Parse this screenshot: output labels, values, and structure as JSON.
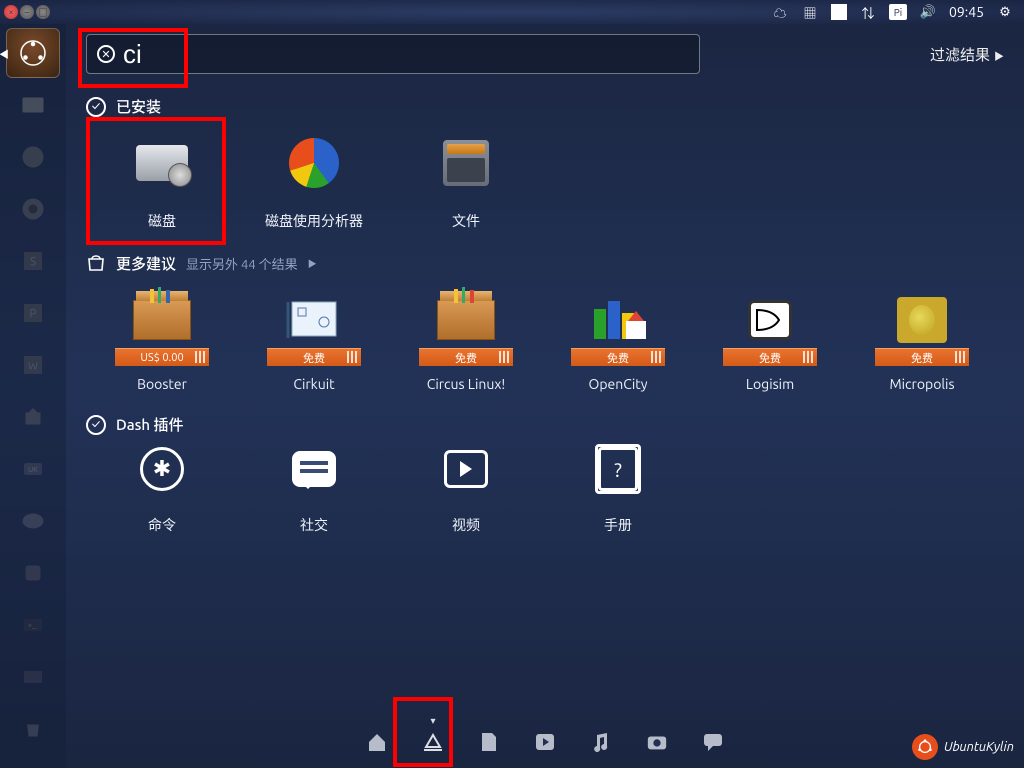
{
  "panel": {
    "time": "09:45",
    "input_indicator": "Pi"
  },
  "search": {
    "value": "ci"
  },
  "filter_label": "过滤结果",
  "sections": {
    "installed": {
      "title": "已安装",
      "apps": [
        {
          "label": "磁盘"
        },
        {
          "label": "磁盘使用分析器"
        },
        {
          "label": "文件"
        }
      ]
    },
    "suggestions": {
      "title": "更多建议",
      "more_label": "显示另外 44 个结果",
      "apps": [
        {
          "label": "Booster",
          "price": "US$ 0.00"
        },
        {
          "label": "Cirkuit",
          "price": "免费"
        },
        {
          "label": "Circus Linux!",
          "price": "免费"
        },
        {
          "label": "OpenCity",
          "price": "免费"
        },
        {
          "label": "Logisim",
          "price": "免费"
        },
        {
          "label": "Micropolis",
          "price": "免费"
        }
      ]
    },
    "dash_plugins": {
      "title": "Dash 插件",
      "apps": [
        {
          "label": "命令"
        },
        {
          "label": "社交"
        },
        {
          "label": "视频"
        },
        {
          "label": "手册"
        }
      ]
    }
  },
  "brand": "UbuntuKylin"
}
